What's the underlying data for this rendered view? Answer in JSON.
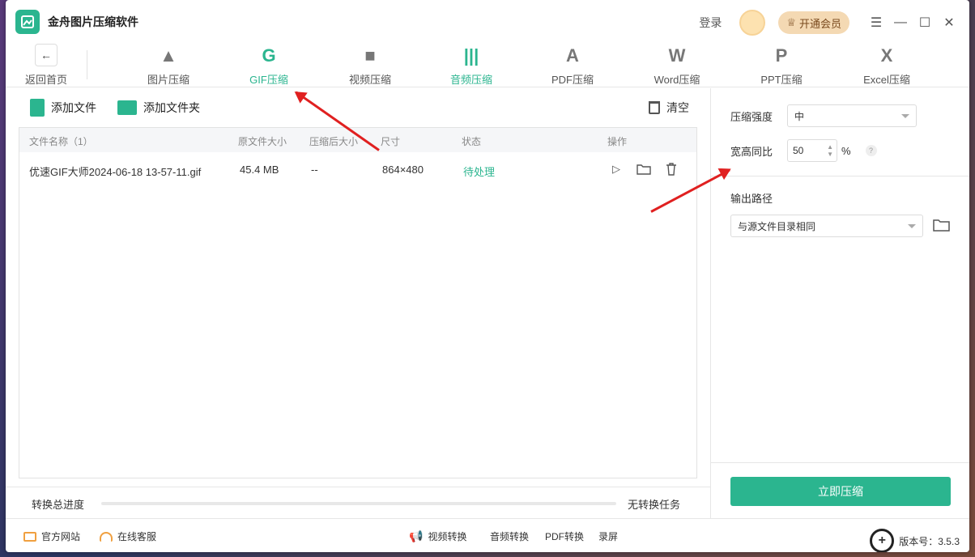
{
  "app": {
    "title": "金舟图片压缩软件",
    "login": "登录",
    "vip": "开通会员"
  },
  "window_controls": [
    "menu-icon",
    "minimize-icon",
    "maximize-icon",
    "close-icon"
  ],
  "toolbar": {
    "back_label": "返回首页",
    "tools": [
      {
        "label": "图片压缩",
        "icon": "image-icon",
        "glyph": "▲"
      },
      {
        "label": "GIF压缩",
        "icon": "gif-icon",
        "glyph": "G",
        "active": true
      },
      {
        "label": "视频压缩",
        "icon": "video-icon",
        "glyph": "■"
      },
      {
        "label": "音频压缩",
        "icon": "audio-icon",
        "glyph": "|||"
      },
      {
        "label": "PDF压缩",
        "icon": "pdf-icon",
        "glyph": "A"
      },
      {
        "label": "Word压缩",
        "icon": "word-icon",
        "glyph": "W"
      },
      {
        "label": "PPT压缩",
        "icon": "ppt-icon",
        "glyph": "P"
      },
      {
        "label": "Excel压缩",
        "icon": "excel-icon",
        "glyph": "X"
      }
    ]
  },
  "actions": {
    "add_file": "添加文件",
    "add_folder": "添加文件夹",
    "clear": "清空"
  },
  "table": {
    "headers": {
      "name": "文件名称（1）",
      "orig_size": "原文件大小",
      "comp_size": "压缩后大小",
      "dimension": "尺寸",
      "status": "状态",
      "ops": "操作"
    },
    "rows": [
      {
        "name": "优速GIF大师2024-06-18 13-57-11.gif",
        "orig_size": "45.4 MB",
        "comp_size": "--",
        "dimension": "864×480",
        "status": "待处理"
      }
    ]
  },
  "progress": {
    "label": "转换总进度",
    "status": "无转换任务",
    "value": 0
  },
  "settings": {
    "strength_label": "压缩强度",
    "strength_value": "中",
    "ratio_label": "宽高同比",
    "ratio_value": "50",
    "ratio_unit": "%",
    "help": "?",
    "output_label": "输出路径",
    "output_value": "与源文件目录相同",
    "compress_button": "立即压缩"
  },
  "footer": {
    "website": "官方网站",
    "support": "在线客服",
    "video_convert": "视频转换",
    "audio_convert": "音频转换",
    "pdf_convert": "PDF转换",
    "record": "录屏",
    "version": "版本号：3.5.3"
  },
  "colors": {
    "accent": "#2bb58f",
    "annotation": "#e02020",
    "vip_bg": "#f4d9b3"
  }
}
